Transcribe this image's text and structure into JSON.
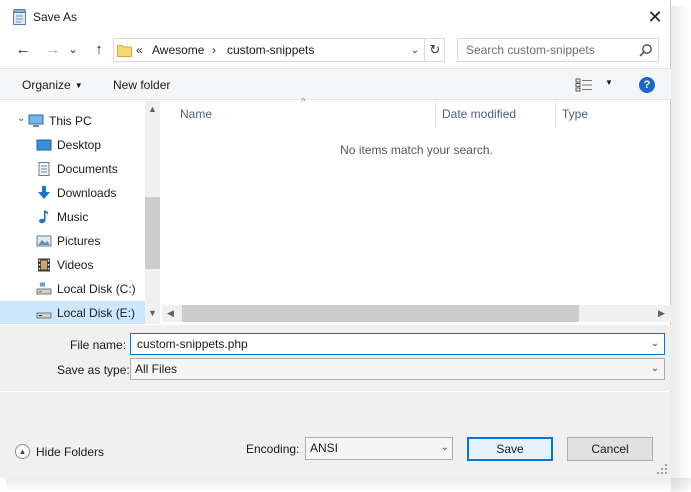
{
  "window": {
    "title": "Save As",
    "close_glyph": "✕"
  },
  "nav": {
    "back_glyph": "←",
    "forward_glyph": "→",
    "recent_glyph": "⌄",
    "up_glyph": "↑",
    "breadcrumb_overflow": "«",
    "breadcrumb_sep": "›",
    "breadcrumbs": [
      "Awesome",
      "custom-snippets"
    ],
    "address_dropdown_glyph": "⌄",
    "refresh_glyph": "↻",
    "search_placeholder": "Search custom-snippets"
  },
  "toolbar": {
    "organize_label": "Organize",
    "organize_caret": "▼",
    "new_folder_label": "New folder",
    "view_caret": "▼",
    "help_label": "?"
  },
  "sidebar": {
    "items": [
      {
        "label": "This PC",
        "icon": "computer-icon"
      },
      {
        "label": "Desktop",
        "icon": "desktop-icon"
      },
      {
        "label": "Documents",
        "icon": "documents-icon"
      },
      {
        "label": "Downloads",
        "icon": "downloads-icon"
      },
      {
        "label": "Music",
        "icon": "music-icon"
      },
      {
        "label": "Pictures",
        "icon": "pictures-icon"
      },
      {
        "label": "Videos",
        "icon": "videos-icon"
      },
      {
        "label": "Local Disk (C:)",
        "icon": "drive-icon"
      },
      {
        "label": "Local Disk (E:)",
        "icon": "drive-icon",
        "selected": true
      }
    ],
    "expand_glyph": "›",
    "scroll_up": "▲",
    "scroll_down": "▼"
  },
  "filelist": {
    "columns": [
      "Name",
      "Date modified",
      "Type"
    ],
    "sort_indicator": "^",
    "empty_message": "No items match your search.",
    "scroll_left": "◀",
    "scroll_right": "▶"
  },
  "form": {
    "filename_label": "File name:",
    "filename_value": "custom-snippets.php",
    "savetype_label": "Save as type:",
    "savetype_value": "All Files",
    "dropdown_glyph": "⌄"
  },
  "bottom": {
    "hide_folders_label": "Hide Folders",
    "hide_folders_glyph": "▲",
    "encoding_label": "Encoding:",
    "encoding_value": "ANSI",
    "encoding_dropdown": "⌄",
    "save_label": "Save",
    "cancel_label": "Cancel"
  },
  "colors": {
    "accent": "#0078d7",
    "selection": "#cce8ff",
    "help": "#1b68c6"
  }
}
